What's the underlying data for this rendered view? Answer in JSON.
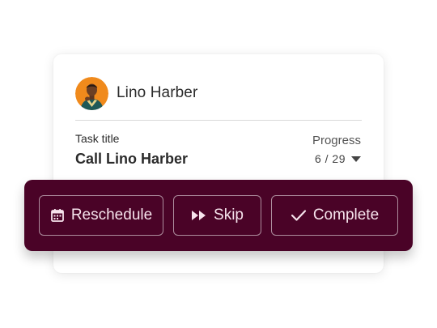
{
  "contact": {
    "name": "Lino Harber",
    "avatar_icon": "person-photo-avatar"
  },
  "task": {
    "label": "Task title",
    "title": "Call Lino Harber"
  },
  "progress": {
    "label": "Progress",
    "value": "6 / 29"
  },
  "actions": {
    "reschedule": {
      "label": "Reschedule",
      "icon": "calendar-icon"
    },
    "skip": {
      "label": "Skip",
      "icon": "fast-forward-icon"
    },
    "complete": {
      "label": "Complete",
      "icon": "checkmark-icon"
    }
  },
  "colors": {
    "action_bar_bg": "#4a0327",
    "action_text": "#f6e3ec",
    "avatar_bg": "#f08a1c"
  }
}
